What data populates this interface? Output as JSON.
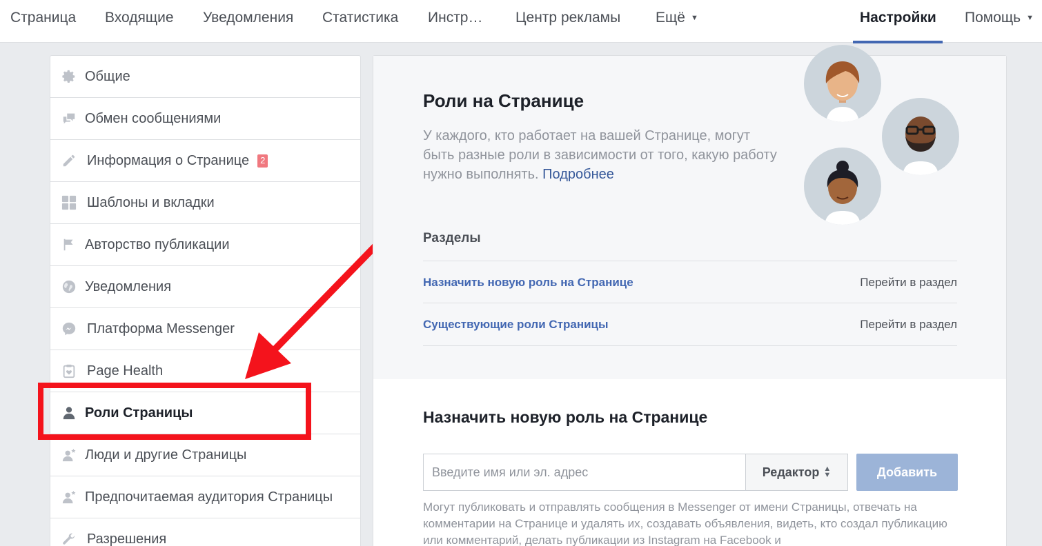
{
  "topnav": {
    "items": [
      {
        "label": "Страница"
      },
      {
        "label": "Входящие"
      },
      {
        "label": "Уведомления"
      },
      {
        "label": "Статистика"
      },
      {
        "label": "Инстр…"
      },
      {
        "label": "Центр рекламы"
      },
      {
        "label": "Ещё"
      },
      {
        "label": "Настройки",
        "active": true
      },
      {
        "label": "Помощь"
      }
    ]
  },
  "sidebar": {
    "items": [
      {
        "label": "Общие",
        "icon": "gear-icon"
      },
      {
        "label": "Обмен сообщениями",
        "icon": "chat-bubbles-icon"
      },
      {
        "label": "Информация о Странице",
        "icon": "pencil-icon",
        "badge": "2"
      },
      {
        "label": "Шаблоны и вкладки",
        "icon": "grid-icon"
      },
      {
        "label": "Авторство публикации",
        "icon": "flag-icon"
      },
      {
        "label": "Уведомления",
        "icon": "globe-icon"
      },
      {
        "label": "Платформа Messenger",
        "icon": "messenger-icon"
      },
      {
        "label": "Page Health",
        "icon": "clipboard-heart-icon"
      },
      {
        "label": "Роли Страницы",
        "icon": "person-icon",
        "active": true
      },
      {
        "label": "Люди и другие Страницы",
        "icon": "person-star-icon"
      },
      {
        "label": "Предпочитаемая аудитория Страницы",
        "icon": "person-star-icon"
      },
      {
        "label": "Разрешения",
        "icon": "wrench-icon"
      }
    ]
  },
  "main": {
    "title": "Роли на Странице",
    "description": "У каждого, кто работает на вашей Странице, могут быть разные роли в зависимости от того, какую работу нужно выполнять.",
    "learn_more": "Подробнее",
    "sections_title": "Разделы",
    "sections": [
      {
        "label": "Назначить новую роль на Странице",
        "goto": "Перейти в раздел"
      },
      {
        "label": "Существующие роли Страницы",
        "goto": "Перейти в раздел"
      }
    ],
    "assign": {
      "title": "Назначить новую роль на Странице",
      "input_placeholder": "Введите имя или эл. адрес",
      "role_value": "Редактор",
      "add_label": "Добавить",
      "description": "Могут публиковать и отправлять сообщения в Messenger от имени Страницы, отвечать на комментарии на Странице и удалять их, создавать объявления, видеть, кто создал публикацию или комментарий, делать публикации из Instagram на Facebook и"
    }
  },
  "colors": {
    "accent": "#4267b2",
    "highlight": "#f4131c",
    "badge": "#f0787f",
    "add_button": "#9cb4d8"
  }
}
